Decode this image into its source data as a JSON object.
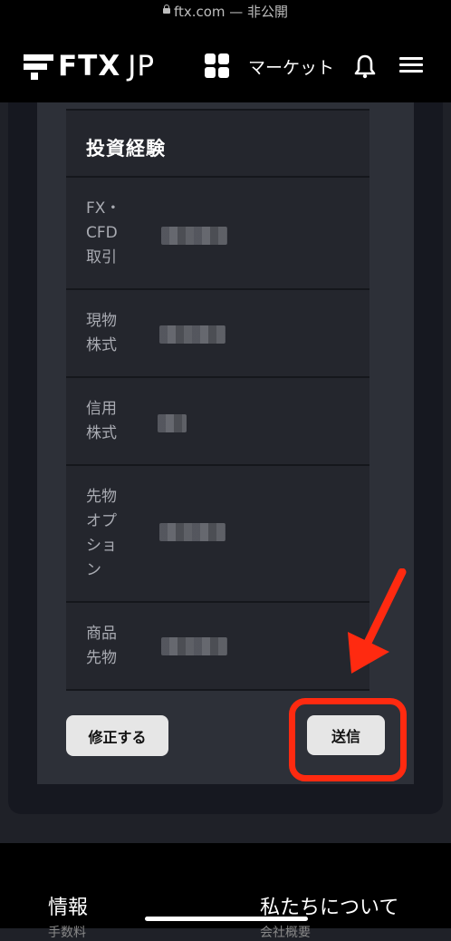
{
  "browser": {
    "url": "ftx.com — 非公開"
  },
  "header": {
    "logo_text": "FTX",
    "logo_suffix": "JP",
    "market_label": "マーケット",
    "icons": [
      "grid-icon",
      "bell-icon",
      "hamburger-icon"
    ]
  },
  "section": {
    "title": "投資経験",
    "rows": [
      {
        "label": "FX・CFD取引",
        "value_blurred": true
      },
      {
        "label": "現物株式",
        "value_blurred": true
      },
      {
        "label": "信用株式",
        "value_blurred": true
      },
      {
        "label": "先物オプション",
        "value_blurred": true
      },
      {
        "label": "商品先物",
        "value_blurred": true
      }
    ]
  },
  "actions": {
    "fix_label": "修正する",
    "send_label": "送信"
  },
  "annotation": {
    "color": "#ff2a10"
  },
  "footer": {
    "col1_title": "情報",
    "col2_title": "私たちについて",
    "col1_sub": "手数料",
    "col2_sub": "会社概要"
  }
}
